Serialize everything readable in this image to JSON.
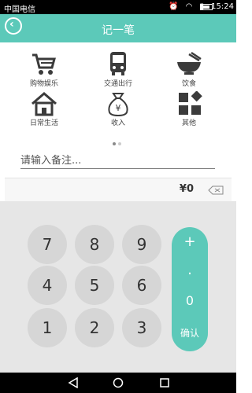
{
  "status_bar": {
    "carrier": "中国电信",
    "time": "15:24"
  },
  "header": {
    "title": "记一笔"
  },
  "categories": [
    {
      "label": "购物娱乐",
      "icon": "shopping-cart-icon"
    },
    {
      "label": "交通出行",
      "icon": "bus-icon"
    },
    {
      "label": "饮食",
      "icon": "bowl-icon"
    },
    {
      "label": "日常生活",
      "icon": "house-icon"
    },
    {
      "label": "收入",
      "icon": "money-bag-icon"
    },
    {
      "label": "其他",
      "icon": "grid-icon"
    }
  ],
  "note": {
    "placeholder": "请输入备注..."
  },
  "amount": {
    "display": "¥0"
  },
  "keypad": {
    "digits": [
      "7",
      "8",
      "9",
      "4",
      "5",
      "6",
      "1",
      "2",
      "3"
    ],
    "plus": "+",
    "dot": ".",
    "zero": "0",
    "confirm": "确认"
  },
  "colors": {
    "accent": "#5cc9b9"
  }
}
